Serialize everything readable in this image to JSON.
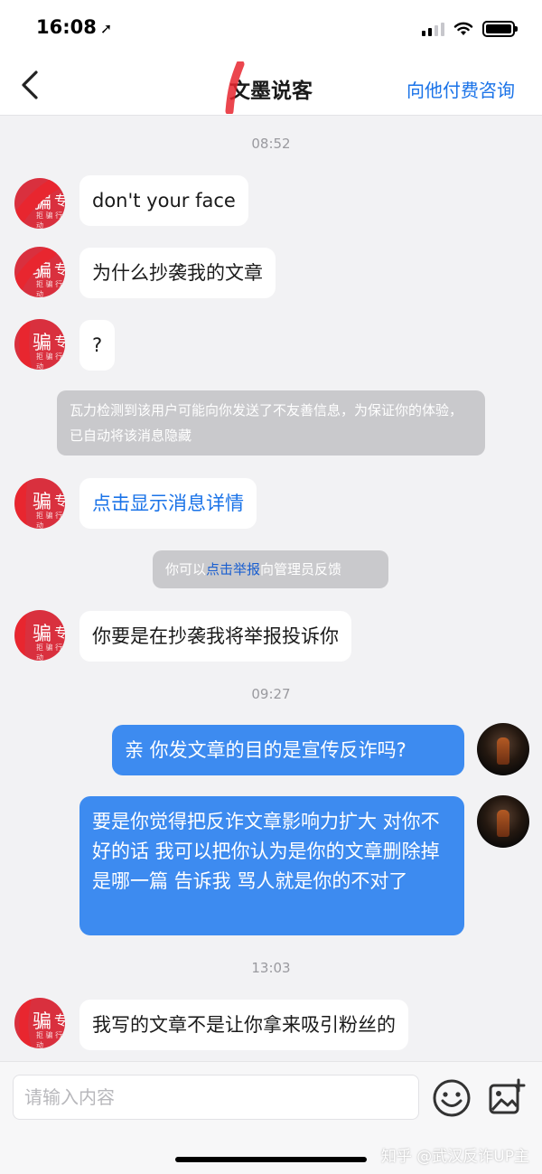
{
  "status_bar": {
    "time": "16:08",
    "location_arrow": "➚"
  },
  "nav": {
    "title": "文墨说客",
    "action": "向他付费咨询"
  },
  "avatar_left": {
    "char": "骗",
    "char2": "专",
    "sub": "拒 骗 行 动"
  },
  "timestamps": [
    "08:52",
    "09:27",
    "13:03"
  ],
  "messages": {
    "m1": "don't your face",
    "m2": "为什么抄袭我的文章",
    "m3": "?",
    "system1": "瓦力检测到该用户可能向你发送了不友善信息，为保证你的体验，已自动将该消息隐藏",
    "m4": "点击显示消息详情",
    "system2_prefix": "你可以",
    "system2_link": "点击举报",
    "system2_suffix": "向管理员反馈",
    "m5": "你要是在抄袭我将举报投诉你",
    "m6": "亲  你发文章的目的是宣传反诈吗?",
    "m7": "要是你觉得把反诈文章影响力扩大 对你不好的话  我可以把你认为是你的文章删除掉   是哪一篇  告诉我  骂人就是你的不对了",
    "m8": "我写的文章不是让你拿来吸引粉丝的"
  },
  "input": {
    "placeholder": "请输入内容"
  },
  "watermark": "知乎 @武汉反诈UP主",
  "colors": {
    "accent": "#1a73e8",
    "sent_bubble": "#3d8bf0",
    "system_box": "#c9c9cc",
    "redaction": "#e8262f"
  }
}
